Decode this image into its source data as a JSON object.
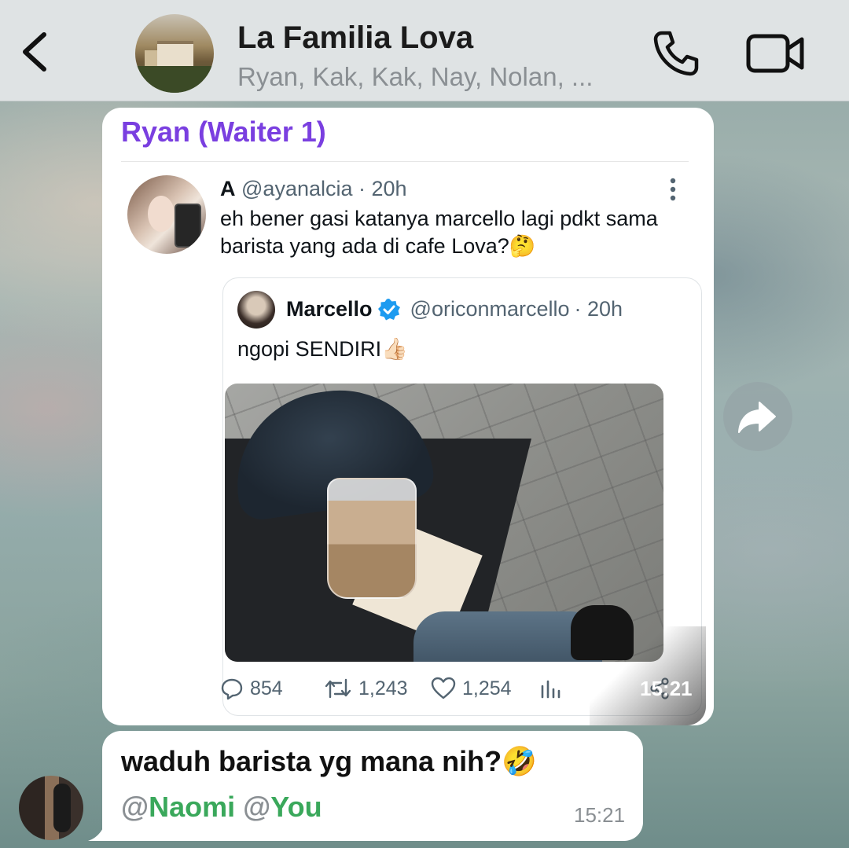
{
  "header": {
    "title": "La Familia Lova",
    "subtitle": "Ryan, Kak, Kak, Nay, Nolan, ..."
  },
  "messages": [
    {
      "sender": "Ryan (Waiter 1)",
      "tweet": {
        "name": "A",
        "handle": "@ayanalcia",
        "age": "· 20h",
        "text": "eh bener gasi katanya marcello lagi pdkt sama barista yang ada di cafe Lova?🤔",
        "quote": {
          "name": "Marcello",
          "handle": "@oriconmarcello",
          "age": "· 20h",
          "text": "ngopi SENDIRI👍🏻"
        },
        "stats": {
          "replies": "854",
          "retweets": "1,243",
          "likes": "1,254"
        }
      },
      "time": "15:21"
    },
    {
      "text": "waduh barista yg mana nih?🤣",
      "mentions": [
        {
          "at": "@",
          "name": "Naomi"
        },
        {
          "at": "@",
          "name": "You"
        }
      ],
      "time": "15:21"
    }
  ],
  "colors": {
    "sender_name": "#7a3fe0",
    "mention": "#3aa85b",
    "header_bg": "#dfe3e4"
  }
}
